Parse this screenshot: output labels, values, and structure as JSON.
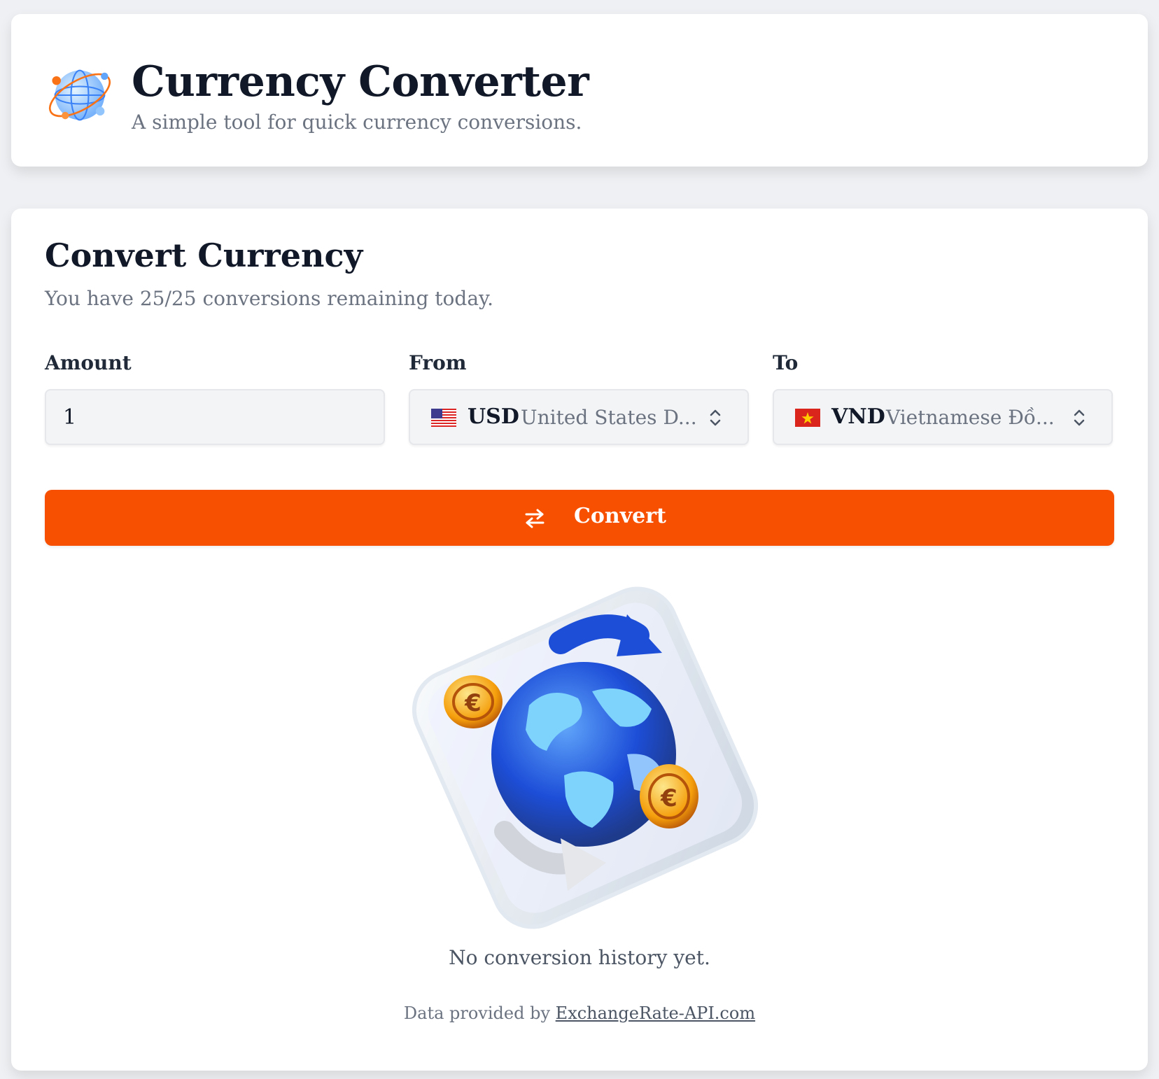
{
  "header": {
    "title": "Currency Converter",
    "subtitle": "A simple tool for quick currency conversions.",
    "logo_icon": "globe-network-icon"
  },
  "converter": {
    "title": "Convert Currency",
    "remaining_text": "You have 25/25 conversions remaining today.",
    "amount": {
      "label": "Amount",
      "value": "1"
    },
    "from": {
      "label": "From",
      "code": "USD",
      "name": "United States D...",
      "flag_icon": "us-flag-icon"
    },
    "to": {
      "label": "To",
      "code": "VND",
      "name": "Vietnamese Đồ...",
      "flag_icon": "vietnam-flag-icon"
    },
    "convert_button": {
      "label": "Convert",
      "icon": "swap-arrows-icon"
    }
  },
  "history": {
    "illustration_icon": "globe-exchange-illustration",
    "empty_text": "No conversion history yet."
  },
  "footer": {
    "prefix": "Data provided by",
    "link_text": "ExchangeRate-API.com"
  },
  "colors": {
    "accent": "#f75000",
    "background": "#eef0f3",
    "card": "#ffffff",
    "muted_text": "#6b7280"
  }
}
